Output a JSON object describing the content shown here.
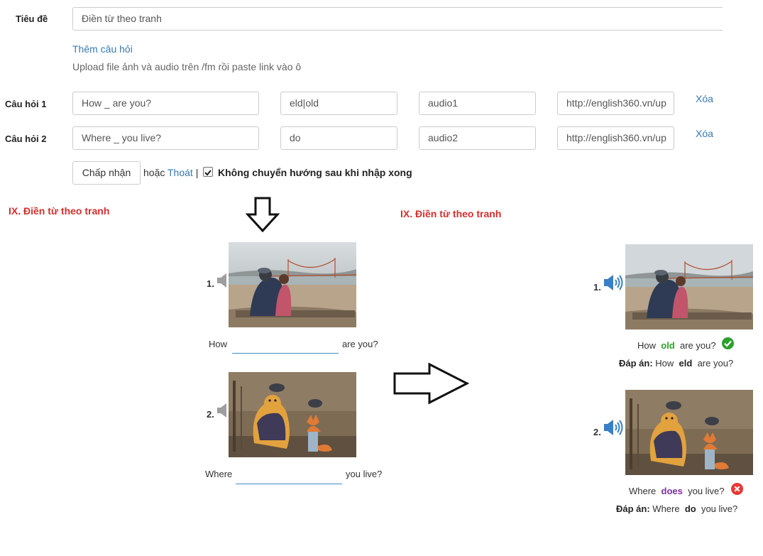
{
  "form": {
    "title_label": "Tiêu đề",
    "title_value": "Điền từ theo tranh",
    "add_question_link": "Thêm câu hỏi",
    "upload_hint": "Upload file ảnh và audio trên /fm rồi paste link vào ô",
    "questions": [
      {
        "label": "Câu hỏi 1",
        "question": "How _ are you?",
        "answer": "eld|old",
        "audio": "audio1",
        "image_url": "http://english360.vn/up",
        "delete_label": "Xóa"
      },
      {
        "label": "Câu hỏi 2",
        "question": "Where _ you live?",
        "answer": "do",
        "audio": "audio2",
        "image_url": "http://english360.vn/up",
        "delete_label": "Xóa"
      }
    ],
    "accept_button": "Chấp nhận",
    "or_text": "hoặc",
    "exit_link": "Thoát",
    "separator": "|",
    "no_redirect_label": "Không chuyển hướng sau khi nhập xong",
    "no_redirect_checked": true
  },
  "preview_left": {
    "heading": "IX. Điền từ theo tranh",
    "items": [
      {
        "number": "1.",
        "before": "How",
        "after": "are you?"
      },
      {
        "number": "2.",
        "before": "Where",
        "after": "you live?"
      }
    ]
  },
  "preview_right": {
    "heading": "IX. Điền từ theo tranh",
    "answer_label": "Đáp án:",
    "items": [
      {
        "number": "1.",
        "before": "How",
        "user_answer": "old",
        "after": "are you?",
        "correct": true,
        "correct_answer": "eld"
      },
      {
        "number": "2.",
        "before": "Where",
        "user_answer": "does",
        "after": "you live?",
        "correct": false,
        "correct_answer": "do"
      }
    ]
  },
  "colors": {
    "accent_link": "#337ab7",
    "heading_red": "#d32f2f",
    "correct_green": "#2ca02c",
    "wrong_red": "#e53935",
    "speaker_active": "#3a7fc4",
    "speaker_inactive": "#9e9e9e"
  },
  "icons": {
    "speaker": "speaker-icon",
    "check": "check-circle-icon",
    "cross": "x-circle-icon",
    "arrow_down": "arrow-down-outline-icon",
    "arrow_right": "arrow-right-outline-icon"
  }
}
